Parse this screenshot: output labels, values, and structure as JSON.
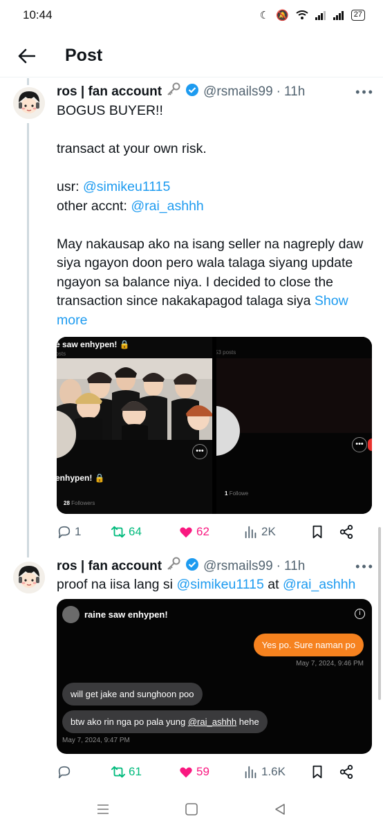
{
  "status_bar": {
    "time": "10:44",
    "battery": "27"
  },
  "header": {
    "title": "Post"
  },
  "tweets": [
    {
      "author": "ros | fan account",
      "handle": "@rsmails99",
      "separator": "·",
      "time": "11h",
      "lines": [
        "BOGUS BUYER!!",
        "transact at your own risk.",
        "usr: ",
        "@simikeu1115",
        "other accnt: ",
        "@rai_ashhh",
        "May nakausap ako na isang seller na nagreply daw siya ngayon doon pero wala talaga siyang update ngayon sa balance niya. I decided to close the transaction since nakakapagod talaga siya",
        "Show more"
      ],
      "media": {
        "left": {
          "title": "e saw enhypen! 🔒",
          "subtitle": "posts",
          "name": "enhypen! 🔒",
          "followers_count": "28",
          "followers_label": "Followers"
        },
        "right": {
          "subtitle": "53 posts",
          "followers_count": "1",
          "followers_label": "Followe"
        }
      },
      "actions": {
        "replies": "1",
        "reposts": "64",
        "likes": "62",
        "views": "2K"
      }
    },
    {
      "author": "ros | fan account",
      "handle": "@rsmails99",
      "separator": "·",
      "time": "11h",
      "text_prefix": "proof na iisa lang si ",
      "mention1": "@simikeu1115",
      "text_mid": " at ",
      "mention2": "@rai_ashhh",
      "chat": {
        "name": "raine saw enhypen!",
        "my_message": "Yes po. Sure naman po",
        "my_time": "May 7, 2024, 9:46 PM",
        "their_message_1": "will get jake and sunghoon poo",
        "their_message_2_prefix": "btw ako rin nga po pala yung ",
        "their_message_2_mention": "@rai_ashhh",
        "their_message_2_suffix": " hehe",
        "their_time": "May 7, 2024, 9:47 PM"
      },
      "actions": {
        "replies": "",
        "reposts": "61",
        "likes": "59",
        "views": "1.6K"
      }
    }
  ],
  "colors": {
    "link": "#1d9bf0",
    "repost": "#00ba7c",
    "like": "#f91880",
    "verified": "#1d9bf0",
    "chat_me": "#f6821f"
  }
}
